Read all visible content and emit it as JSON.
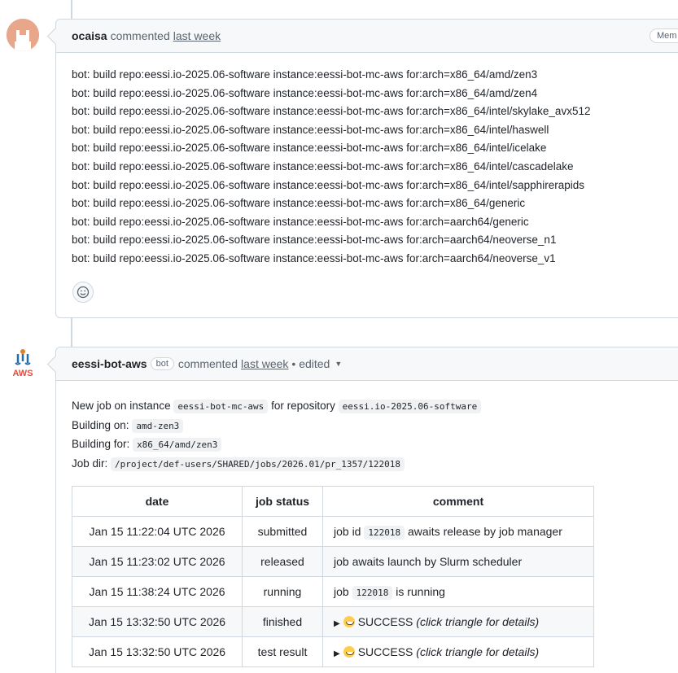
{
  "comment1": {
    "author": "ocaisa",
    "action": "commented",
    "time": "last week",
    "badge": "Mem",
    "lines": [
      "bot: build repo:eessi.io-2025.06-software instance:eessi-bot-mc-aws for:arch=x86_64/amd/zen3",
      "bot: build repo:eessi.io-2025.06-software instance:eessi-bot-mc-aws for:arch=x86_64/amd/zen4",
      "bot: build repo:eessi.io-2025.06-software instance:eessi-bot-mc-aws for:arch=x86_64/intel/skylake_avx512",
      "bot: build repo:eessi.io-2025.06-software instance:eessi-bot-mc-aws for:arch=x86_64/intel/haswell",
      "bot: build repo:eessi.io-2025.06-software instance:eessi-bot-mc-aws for:arch=x86_64/intel/icelake",
      "bot: build repo:eessi.io-2025.06-software instance:eessi-bot-mc-aws for:arch=x86_64/intel/cascadelake",
      "bot: build repo:eessi.io-2025.06-software instance:eessi-bot-mc-aws for:arch=x86_64/intel/sapphirerapids",
      "bot: build repo:eessi.io-2025.06-software instance:eessi-bot-mc-aws for:arch=x86_64/generic",
      "bot: build repo:eessi.io-2025.06-software instance:eessi-bot-mc-aws for:arch=aarch64/generic",
      "bot: build repo:eessi.io-2025.06-software instance:eessi-bot-mc-aws for:arch=aarch64/neoverse_n1",
      "bot: build repo:eessi.io-2025.06-software instance:eessi-bot-mc-aws for:arch=aarch64/neoverse_v1"
    ],
    "reaction_icon": "smiley-icon"
  },
  "comment2": {
    "author": "eessi-bot-aws",
    "bot_badge": "bot",
    "action": "commented",
    "time": "last week",
    "edited": "• edited",
    "avatar_text": "AWS",
    "intro_prefix": "New job on instance",
    "instance": "eessi-bot-mc-aws",
    "intro_mid": "for repository",
    "repository": "eessi.io-2025.06-software",
    "building_on_label": "Building on:",
    "building_on": "amd-zen3",
    "building_for_label": "Building for:",
    "building_for": "x86_64/amd/zen3",
    "job_dir_label": "Job dir:",
    "job_dir": "/project/def-users/SHARED/jobs/2026.01/pr_1357/122018",
    "table": {
      "headers": [
        "date",
        "job status",
        "comment"
      ],
      "rows": [
        {
          "date": "Jan 15 11:22:04 UTC 2026",
          "status": "submitted",
          "c_pre": "job id",
          "c_code": "122018",
          "c_post": "awaits release by job manager"
        },
        {
          "date": "Jan 15 11:23:02 UTC 2026",
          "status": "released",
          "c_text": "job awaits launch by Slurm scheduler"
        },
        {
          "date": "Jan 15 11:38:24 UTC 2026",
          "status": "running",
          "c_pre": "job",
          "c_code": "122018",
          "c_post": "is running"
        },
        {
          "date": "Jan 15 13:32:50 UTC 2026",
          "status": "finished",
          "c_result": "SUCCESS",
          "c_hint": "(click triangle for details)"
        },
        {
          "date": "Jan 15 13:32:50 UTC 2026",
          "status": "test result",
          "c_result": "SUCCESS",
          "c_hint": "(click triangle for details)"
        }
      ]
    }
  }
}
